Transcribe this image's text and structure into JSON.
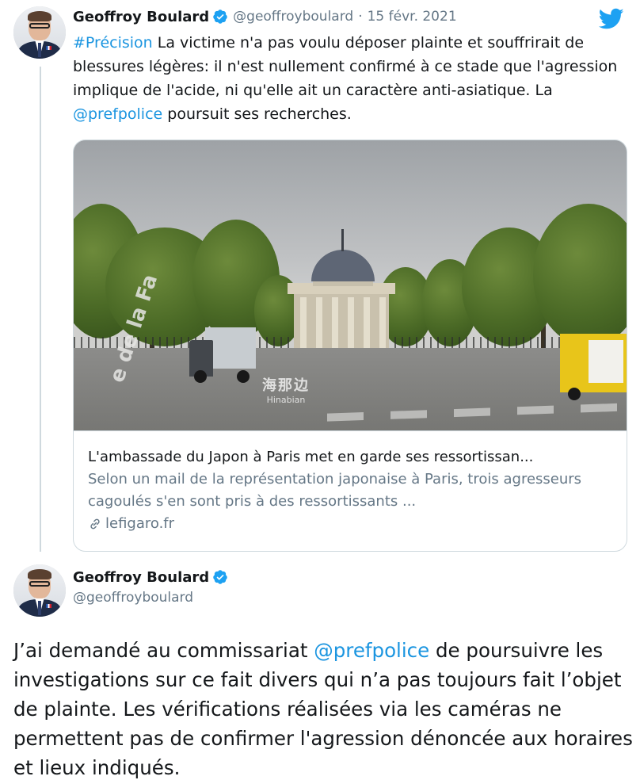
{
  "tweet1": {
    "name": "Geoffroy Boulard",
    "handle": "@geoffroyboulard",
    "separator": "·",
    "date": "15 févr. 2021",
    "hashtag": "#Précision",
    "text_part1": " La victime n'a pas voulu déposer plainte et souffrirait de blessures légères: il n'est nullement confirmé à ce stade que l'agression implique de l'acide, ni qu'elle ait un caractère anti-asiatique. La ",
    "mention": "@prefpolice",
    "text_part2": " poursuit ses recherches."
  },
  "card": {
    "title": "L'ambassade du Japon à Paris met en garde ses ressortissan...",
    "description": "Selon un mail de la représentation japonaise à Paris, trois agresseurs cagoulés s'en sont pris à des ressortissants ...",
    "domain": "lefigaro.fr",
    "image": {
      "street_sign_text": "e de la Fa",
      "watermark_cn": "海那边",
      "watermark_en": "Hinabian"
    }
  },
  "tweet2": {
    "name": "Geoffroy Boulard",
    "handle": "@geoffroyboulard",
    "text_part1": "J’ai demandé au commissariat ",
    "mention": "@prefpolice",
    "text_part2": " de poursuivre les investigations sur ce fait divers qui n’a pas toujours fait l’objet de plainte. Les vérifications réalisées via les caméras ne permettent pas de confirmer l'agression dénoncée aux horaires et lieux indiqués."
  },
  "icons": {
    "verified": "verified-badge-icon",
    "twitter": "twitter-bird-icon",
    "link": "link-icon"
  },
  "colors": {
    "link_blue": "#1b95e0",
    "twitter_blue": "#1da1f2",
    "secondary_text": "#657786",
    "border": "#cfd9de"
  }
}
